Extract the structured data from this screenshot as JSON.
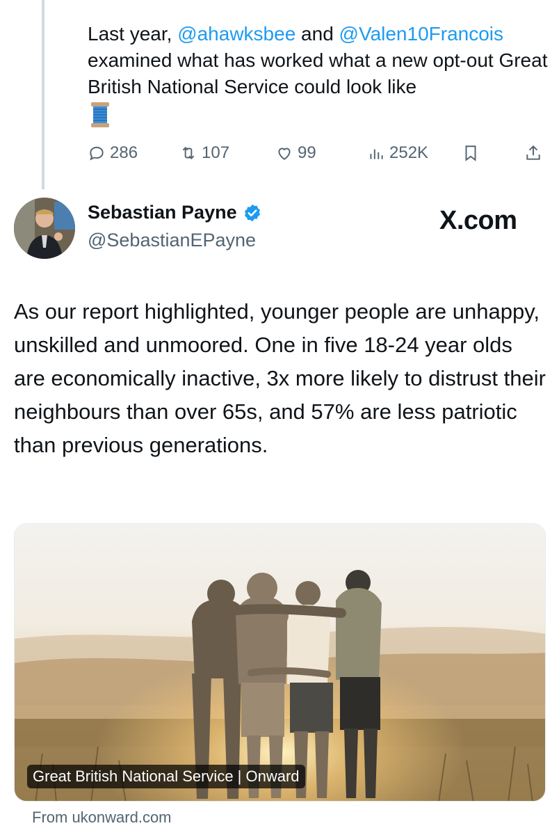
{
  "top_tweet": {
    "text_before": "Last year, ",
    "mention1": "@ahawksbee",
    "text_middle": " and ",
    "mention2": "@Valen10Francois",
    "text_after": " examined what has worked what a new opt-out Great British National Service could look like",
    "emoji_icon": "thread-spool-icon",
    "metrics": {
      "replies": "286",
      "reposts": "107",
      "likes": "99",
      "views": "252K"
    }
  },
  "tweet": {
    "author_name": "Sebastian Payne",
    "author_handle": "@SebastianEPayne",
    "watermark": "X.com",
    "text": "As our report highlighted, younger people are unhappy, unskilled and unmoored. One in five 18-24 year olds are economically inactive, 3x more likely to distrust their neighbours than over 65s, and 57% are less patriotic than previous generations.",
    "card": {
      "title": "Great British National Service | Onward",
      "source": "From ukonward.com"
    }
  },
  "colors": {
    "link": "#1d9bf0",
    "muted": "#536471",
    "text": "#0f1419",
    "verified": "#1d9bf0"
  }
}
